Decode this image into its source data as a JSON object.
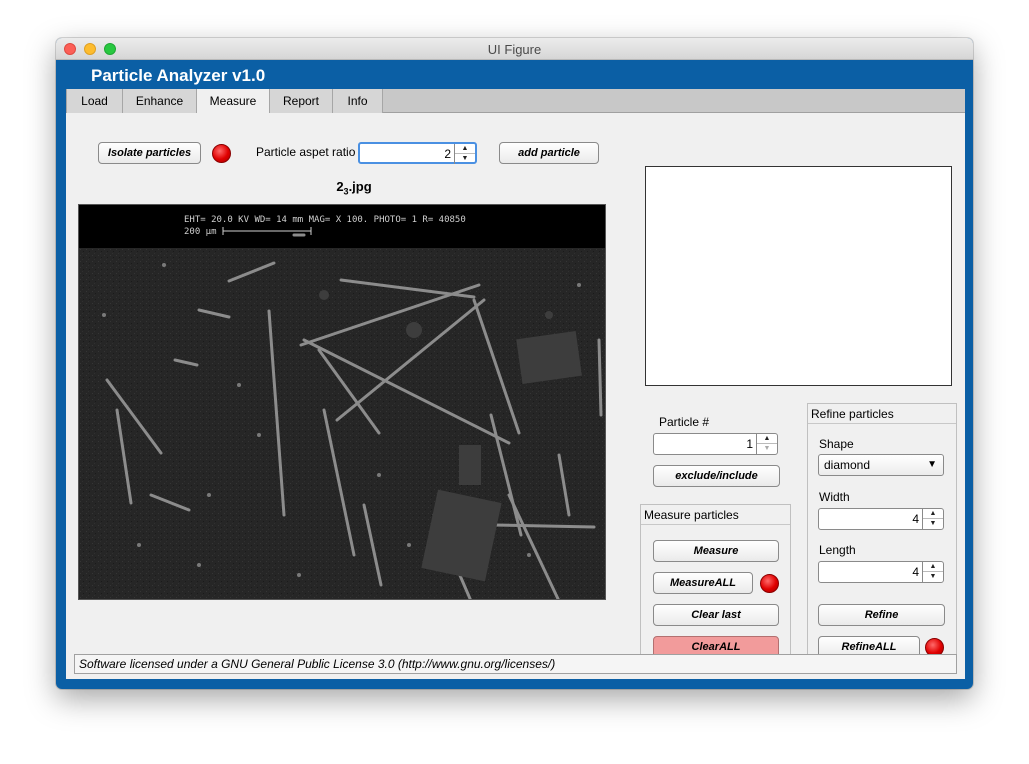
{
  "window": {
    "title": "UI Figure"
  },
  "app": {
    "title": "Particle Analyzer  v1.0"
  },
  "tabs": [
    {
      "label": "Load"
    },
    {
      "label": "Enhance"
    },
    {
      "label": "Measure"
    },
    {
      "label": "Report"
    },
    {
      "label": "Info"
    }
  ],
  "active_tab": "Measure",
  "measure": {
    "isolate_label": "Isolate particles",
    "aspect_label": "Particle aspet ratio",
    "aspect_value": "2",
    "add_particle_label": "add particle",
    "image_name_base": "2",
    "image_name_sub": "3",
    "image_name_ext": ".jpg",
    "sem_header": {
      "line1": "EHT= 20.0 KV   WD= 14   mm     MAG= X 100.   PHOTO= 1     R= 40850",
      "line2": "200 µm"
    },
    "particle_label": "Particle #",
    "particle_value": "1",
    "exclude_label": "exclude/include"
  },
  "measure_group": {
    "title": "Measure particles",
    "measure_label": "Measure",
    "measure_all_label": "MeasureALL",
    "clear_last_label": "Clear last",
    "clear_all_label": "ClearALL"
  },
  "refine_group": {
    "title": "Refine particles",
    "shape_label": "Shape",
    "shape_value": "diamond",
    "width_label": "Width",
    "width_value": "4",
    "length_label": "Length",
    "length_value": "4",
    "refine_label": "Refine",
    "refine_all_label": "RefineALL"
  },
  "status": {
    "text": "Software licensed under a GNU General Public License 3.0 (http://www.gnu.org/licenses/)"
  },
  "colors": {
    "header_blue": "#0b5fa5",
    "lamp_red": "#e00000",
    "clear_all_pink": "#f29b9b"
  },
  "icons": {
    "spinner_up": "▲",
    "spinner_down": "▼",
    "dropdown_caret": "▼"
  }
}
